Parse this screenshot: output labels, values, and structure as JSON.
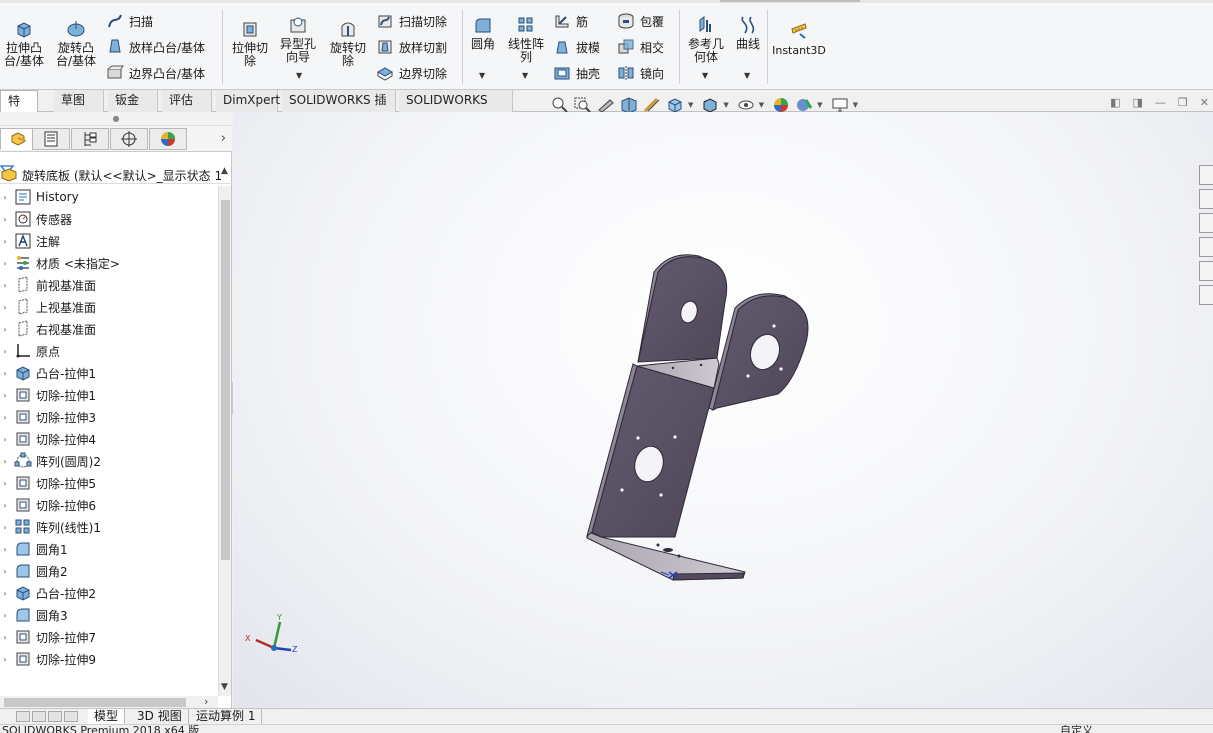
{
  "ribbon": {
    "extrude_boss": "拉伸凸\n台/基体",
    "revolve_boss": "旋转凸\n台/基体",
    "sweep": "扫描",
    "loft_boss": "放样凸台/基体",
    "boundary_boss": "边界凸台/基体",
    "extrude_cut": "拉伸切\n除",
    "hole_wizard": "异型孔\n向导",
    "revolve_cut": "旋转切\n除",
    "swept_cut": "扫描切除",
    "lofted_cut": "放样切割",
    "boundary_cut": "边界切除",
    "fillet": "圆角",
    "linear_pattern": "线性阵\n列",
    "rib": "筋",
    "draft": "拔模",
    "shell": "抽壳",
    "wrap": "包覆",
    "intersect": "相交",
    "mirror": "镜向",
    "ref_geometry": "参考几\n何体",
    "curves": "曲线",
    "instant3d": "Instant3D"
  },
  "tabs": [
    "特征",
    "草图",
    "钣金",
    "评估",
    "DimXpert",
    "SOLIDWORKS 插件",
    "SOLIDWORKS MBD"
  ],
  "tree": {
    "root": "旋转底板 (默认<<默认>_显示状态 1",
    "items": [
      {
        "label": "History",
        "icon": "history-folder-icon"
      },
      {
        "label": "传感器",
        "icon": "sensor-icon"
      },
      {
        "label": "注解",
        "icon": "annotation-icon"
      },
      {
        "label": "材质 <未指定>",
        "icon": "material-icon"
      },
      {
        "label": "前视基准面",
        "icon": "plane-icon"
      },
      {
        "label": "上视基准面",
        "icon": "plane-icon"
      },
      {
        "label": "右视基准面",
        "icon": "plane-icon"
      },
      {
        "label": "原点",
        "icon": "origin-icon"
      },
      {
        "label": "凸台-拉伸1",
        "icon": "boss-extrude-icon"
      },
      {
        "label": "切除-拉伸1",
        "icon": "cut-extrude-icon"
      },
      {
        "label": "切除-拉伸3",
        "icon": "cut-extrude-icon"
      },
      {
        "label": "切除-拉伸4",
        "icon": "cut-extrude-icon"
      },
      {
        "label": "阵列(圆周)2",
        "icon": "circular-pattern-icon"
      },
      {
        "label": "切除-拉伸5",
        "icon": "cut-extrude-icon"
      },
      {
        "label": "切除-拉伸6",
        "icon": "cut-extrude-icon"
      },
      {
        "label": "阵列(线性)1",
        "icon": "linear-pattern-icon"
      },
      {
        "label": "圆角1",
        "icon": "fillet-icon"
      },
      {
        "label": "圆角2",
        "icon": "fillet-icon"
      },
      {
        "label": "凸台-拉伸2",
        "icon": "boss-extrude-icon"
      },
      {
        "label": "圆角3",
        "icon": "fillet-icon"
      },
      {
        "label": "切除-拉伸7",
        "icon": "cut-extrude-icon"
      },
      {
        "label": "切除-拉伸9",
        "icon": "cut-extrude-icon"
      }
    ]
  },
  "triad": {
    "x": "X",
    "y": "Y",
    "z": "Z"
  },
  "bottom_tabs": [
    "模型",
    "3D 视图",
    "运动算例 1"
  ],
  "status": {
    "left": "SOLIDWORKS Premium 2018 x64 版",
    "right": "自定义"
  },
  "colors": {
    "part": "#5b5366",
    "edge": "#2e2936",
    "accent": "#1f6fbf"
  }
}
